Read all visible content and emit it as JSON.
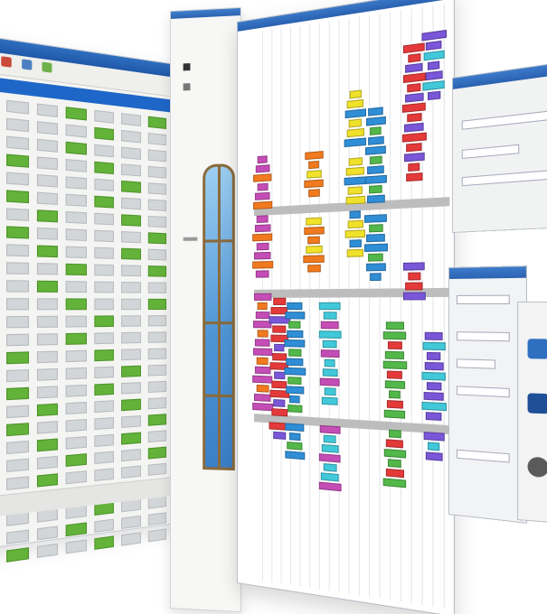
{
  "scene": {
    "palette": {
      "titlebar_blue": "#2f6fc0",
      "grid_green": "#63b23a",
      "grid_gray": "#d3d6d8",
      "block_colors": [
        "#c54db6",
        "#f17a1f",
        "#f0e12a",
        "#2f8ed6",
        "#53b84a",
        "#e53a3a",
        "#7a56d9",
        "#41c9da"
      ]
    },
    "windows": [
      {
        "name": "grid-window",
        "icon_names": [
          "toolbar-icon"
        ]
      },
      {
        "name": "door-panel-window",
        "icon_names": [
          "arch-window-icon"
        ]
      },
      {
        "name": "chart-window",
        "icon_names": []
      },
      {
        "name": "form-window",
        "icon_names": []
      },
      {
        "name": "dialog-window",
        "icon_names": []
      },
      {
        "name": "front-window",
        "icon_names": [
          "button-icon"
        ]
      }
    ]
  }
}
